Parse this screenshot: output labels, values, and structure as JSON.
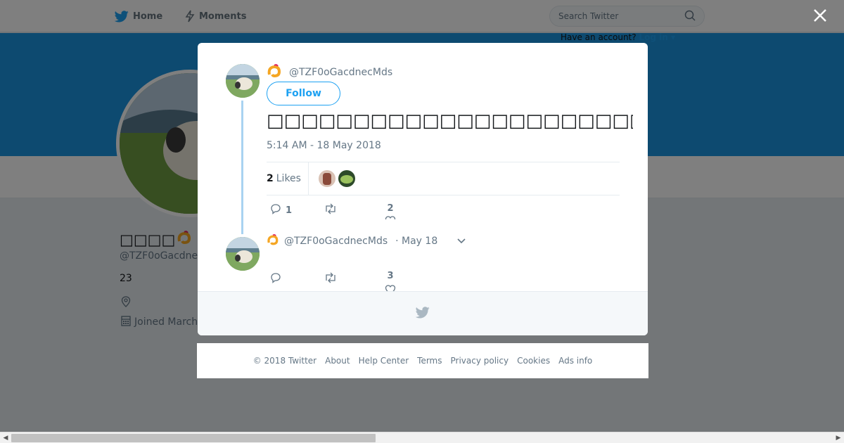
{
  "nav": {
    "home_label": "Home",
    "moments_label": "Moments",
    "search_placeholder": "Search Twitter",
    "account_prompt": "Have an account?",
    "login_label": "Log in ▾"
  },
  "profile": {
    "name": "□□□□",
    "handle": "@TZF0oGacdne",
    "count": "23",
    "joined": "Joined March"
  },
  "tweet": {
    "handle": "@TZF0oGacdnecMds",
    "follow_label": "Follow",
    "text": "□□□□□□□□□□□□□□□□□□□□□□□□□□□□□□□□□□□□□□□□□□□□□",
    "timestamp": "5:14 AM - 18 May 2018",
    "likes_count": "2",
    "likes_label": "Likes",
    "replies": "1",
    "retweets": "",
    "likes": "2"
  },
  "reply": {
    "handle": "@TZF0oGacdnecMds",
    "date": "· May 18",
    "replies": "",
    "retweets": "",
    "likes": "3"
  },
  "footer": {
    "links": [
      "© 2018 Twitter",
      "About",
      "Help Center",
      "Terms",
      "Privacy policy",
      "Cookies",
      "Ads info"
    ]
  },
  "colors": {
    "brand": "#1da1f2",
    "banner": "#1b95e0",
    "thread_line": "#a9d3f1"
  },
  "icons": {
    "close": "close-icon",
    "twitter": "twitter-bird-icon"
  }
}
